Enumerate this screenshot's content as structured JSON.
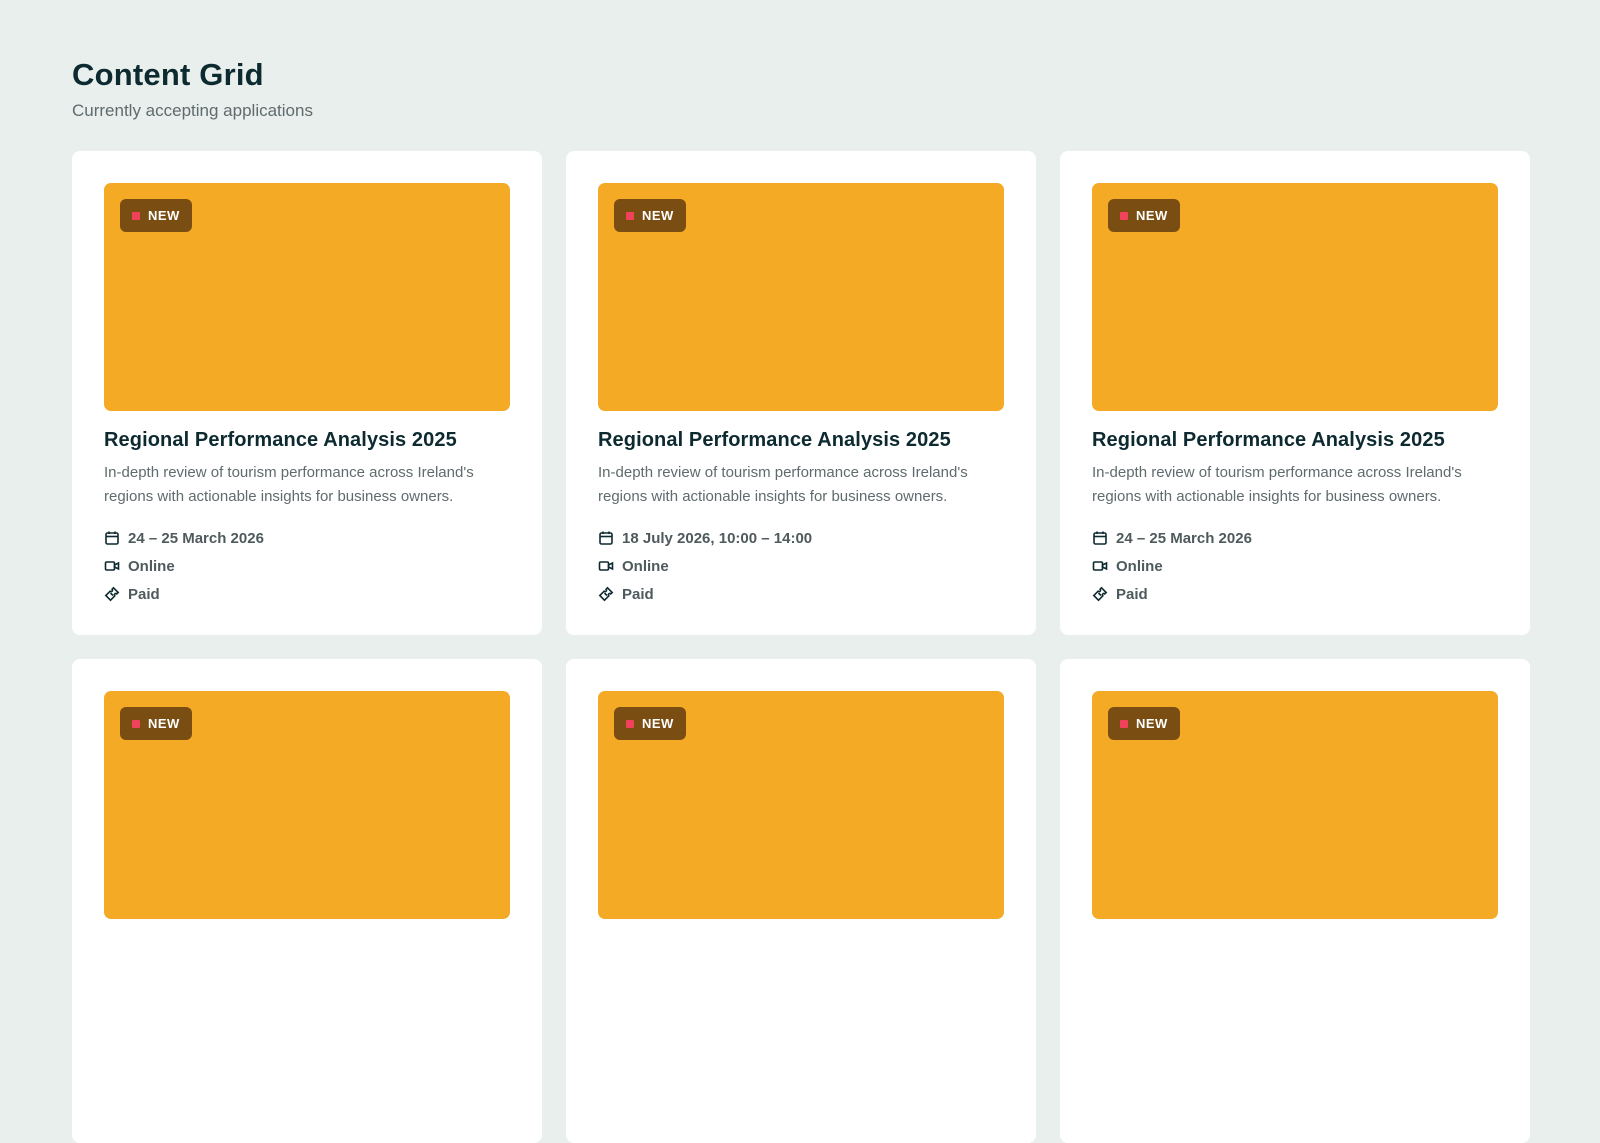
{
  "header": {
    "title": "Content Grid",
    "subtitle": "Currently accepting applications"
  },
  "colors": {
    "background": "#e9efed",
    "card": "#ffffff",
    "media_placeholder": "#f4aa24",
    "badge_bg": "#7a4d12",
    "badge_dot": "#f0425a",
    "title_text": "#0d2a30",
    "muted_text": "#5f6b6d"
  },
  "cards": [
    {
      "badge": "NEW",
      "title": "Regional Performance Analysis 2025",
      "description": "In-depth review of tourism performance across Ireland's regions with actionable insights for business owners.",
      "date": "24 – 25 March 2026",
      "location": "Online",
      "price": "Paid",
      "icons": {
        "date": "calendar-icon",
        "location": "video-camera-icon",
        "price": "ticket-icon"
      }
    },
    {
      "badge": "NEW",
      "title": "Regional Performance Analysis 2025",
      "description": "In-depth review of tourism performance across Ireland's regions with actionable insights for business owners.",
      "date": "18 July 2026, 10:00 – 14:00",
      "location": "Online",
      "price": "Paid",
      "icons": {
        "date": "calendar-icon",
        "location": "video-camera-icon",
        "price": "ticket-icon"
      }
    },
    {
      "badge": "NEW",
      "title": "Regional Performance Analysis 2025",
      "description": "In-depth review of tourism performance across Ireland's regions with actionable insights for business owners.",
      "date": "24 – 25 March 2026",
      "location": "Online",
      "price": "Paid",
      "icons": {
        "date": "calendar-icon",
        "location": "video-camera-icon",
        "price": "ticket-icon"
      }
    },
    {
      "badge": "NEW"
    },
    {
      "badge": "NEW"
    },
    {
      "badge": "NEW"
    }
  ]
}
